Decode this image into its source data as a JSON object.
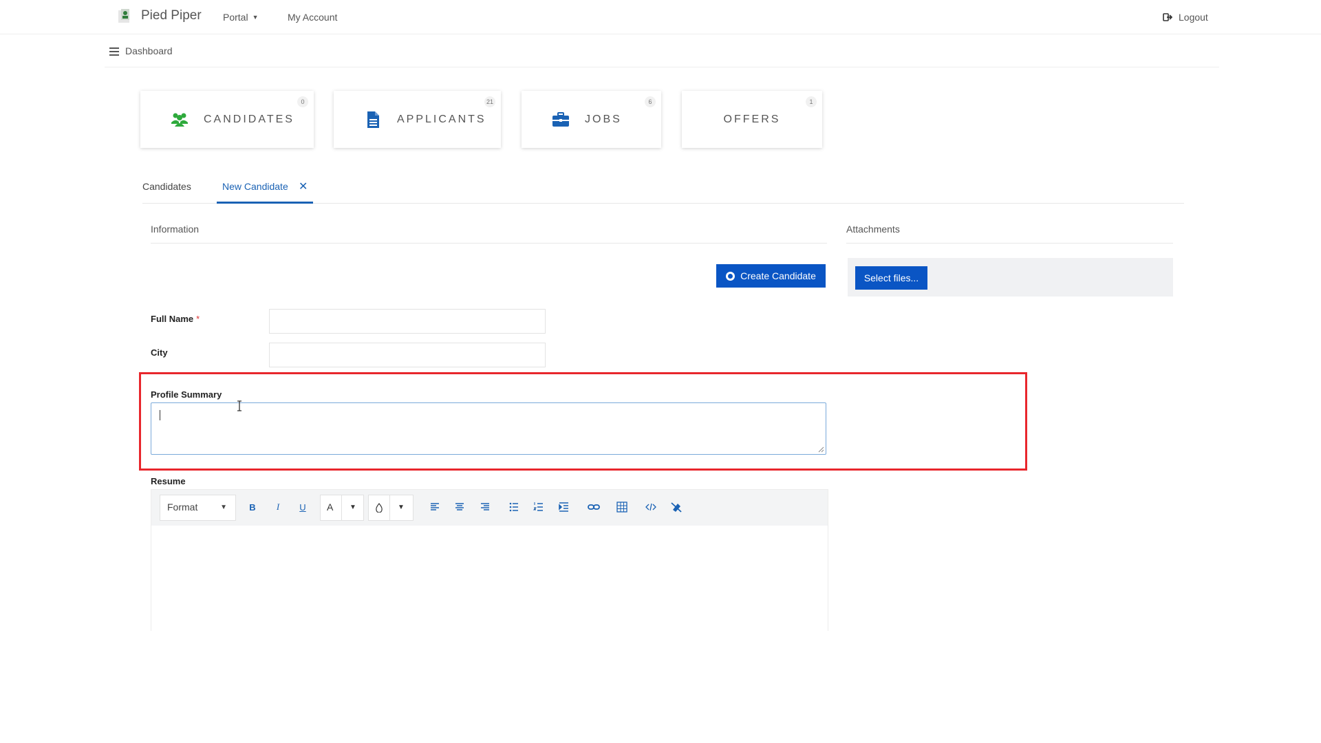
{
  "nav": {
    "brand": "Pied Piper",
    "portal": "Portal",
    "my_account": "My Account",
    "logout": "Logout"
  },
  "breadcrumb": {
    "title": "Dashboard"
  },
  "cards": [
    {
      "label": "CANDIDATES",
      "count": "0",
      "icon": "users-icon",
      "color": "#2eaa3c"
    },
    {
      "label": "APPLICANTS",
      "count": "21",
      "icon": "document-icon",
      "color": "#1a62b4"
    },
    {
      "label": "JOBS",
      "count": "6",
      "icon": "briefcase-icon",
      "color": "#1a62b4"
    },
    {
      "label": "OFFERS",
      "count": "1",
      "icon": "",
      "color": ""
    }
  ],
  "tabs": {
    "candidates": "Candidates",
    "new_candidate": "New Candidate",
    "close": "✕"
  },
  "sections": {
    "information": "Information",
    "attachments": "Attachments"
  },
  "buttons": {
    "create_candidate": "Create Candidate",
    "select_files": "Select files..."
  },
  "form": {
    "full_name_label": "Full Name",
    "required_mark": "*",
    "city_label": "City",
    "profile_summary_label": "Profile Summary",
    "resume_label": "Resume",
    "full_name_value": "",
    "city_value": "",
    "profile_summary_value": ""
  },
  "editor": {
    "format_label": "Format",
    "bold": "B",
    "italic": "I",
    "underline": "U",
    "font_color": "A"
  },
  "colors": {
    "accent": "#0a55c4",
    "highlight": "#e8262c",
    "tab_active": "#1a62b4"
  }
}
